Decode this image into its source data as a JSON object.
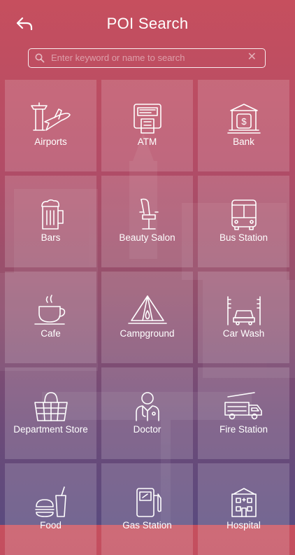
{
  "header": {
    "title": "POI Search"
  },
  "search": {
    "placeholder": "Enter keyword or name to search"
  },
  "tiles": [
    {
      "label": "Airports",
      "icon": "airport-icon"
    },
    {
      "label": "ATM",
      "icon": "atm-icon"
    },
    {
      "label": "Bank",
      "icon": "bank-icon"
    },
    {
      "label": "Bars",
      "icon": "beer-mug-icon"
    },
    {
      "label": "Beauty Salon",
      "icon": "salon-chair-icon"
    },
    {
      "label": "Bus Station",
      "icon": "bus-icon"
    },
    {
      "label": "Cafe",
      "icon": "coffee-cup-icon"
    },
    {
      "label": "Campground",
      "icon": "tent-icon"
    },
    {
      "label": "Car Wash",
      "icon": "car-wash-icon"
    },
    {
      "label": "Department Store",
      "icon": "shopping-basket-icon"
    },
    {
      "label": "Doctor",
      "icon": "doctor-icon"
    },
    {
      "label": "Fire Station",
      "icon": "fire-truck-icon"
    },
    {
      "label": "Food",
      "icon": "fast-food-icon"
    },
    {
      "label": "Gas Station",
      "icon": "fuel-pump-icon"
    },
    {
      "label": "Hospital",
      "icon": "hospital-building-icon"
    }
  ]
}
